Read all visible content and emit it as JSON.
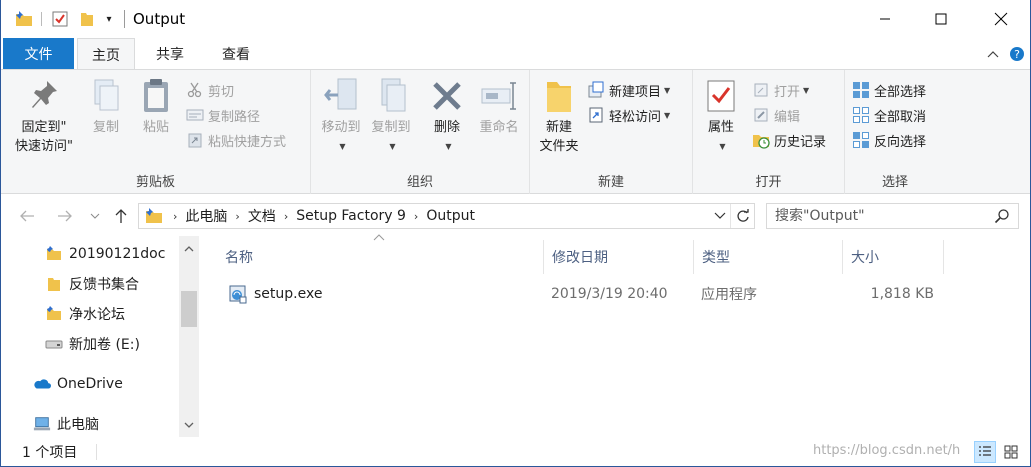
{
  "titlebar": {
    "title": "Output",
    "dropdown_glyph": "▾",
    "icons": [
      "folder-pin-icon",
      "properties-check-icon",
      "new-folder-icon",
      "customize-quick-access-icon"
    ],
    "controls": [
      "minimize-icon",
      "maximize-icon",
      "close-icon"
    ]
  },
  "tabs": {
    "file": "文件",
    "home": "主页",
    "share": "共享",
    "view": "查看"
  },
  "ribbon": {
    "clipboard": {
      "label": "剪贴板",
      "pin_line1": "固定到\"",
      "pin_line2": "快速访问\"",
      "copy": "复制",
      "paste": "粘贴",
      "cut": "剪切",
      "copy_path": "复制路径",
      "paste_shortcut": "粘贴快捷方式"
    },
    "organize": {
      "label": "组织",
      "move_to": "移动到",
      "copy_to": "复制到",
      "delete": "删除",
      "rename": "重命名"
    },
    "new": {
      "label": "新建",
      "new_folder_line1": "新建",
      "new_folder_line2": "文件夹",
      "new_item": "新建项目",
      "easy_access": "轻松访问"
    },
    "open": {
      "label": "打开",
      "properties": "属性",
      "open": "打开",
      "edit": "编辑",
      "history": "历史记录"
    },
    "select": {
      "label": "选择",
      "select_all": "全部选择",
      "select_none": "全部取消",
      "invert": "反向选择"
    }
  },
  "address": {
    "crumbs": [
      "此电脑",
      "文档",
      "Setup Factory 9",
      "Output"
    ]
  },
  "search": {
    "placeholder": "搜索\"Output\""
  },
  "navpane": {
    "items": [
      {
        "label": "20190121doc",
        "icon": "folder-pin-icon"
      },
      {
        "label": "反馈书集合",
        "icon": "folder-icon"
      },
      {
        "label": "净水论坛",
        "icon": "folder-pin-icon"
      },
      {
        "label": "新加卷 (E:)",
        "icon": "drive-icon"
      },
      {
        "label": "OneDrive",
        "icon": "onedrive-icon"
      },
      {
        "label": "此电脑",
        "icon": "computer-icon"
      }
    ]
  },
  "columns": [
    "名称",
    "修改日期",
    "类型",
    "大小"
  ],
  "files": [
    {
      "name": "setup.exe",
      "modified": "2019/3/19 20:40",
      "type": "应用程序",
      "size": "1,818 KB"
    }
  ],
  "status": {
    "count": "1 个项目",
    "watermark": "https://blog.csdn.net/h"
  },
  "colors": {
    "accent": "#1979ca",
    "ribbon_bg": "#f5f6f7",
    "folder": "#f0c24b",
    "header_text": "#4d6082"
  }
}
